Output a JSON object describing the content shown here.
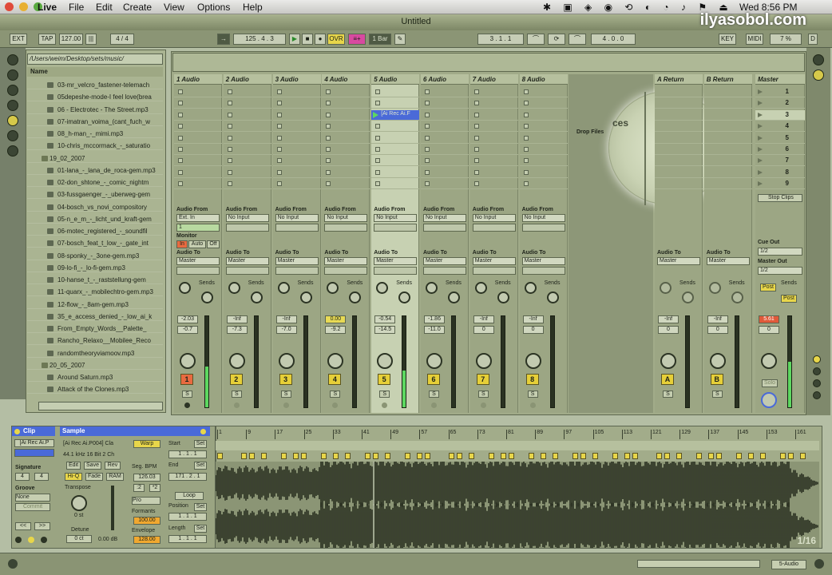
{
  "menubar": {
    "app_name": "Live",
    "items": [
      "File",
      "Edit",
      "Create",
      "View",
      "Options",
      "Help"
    ],
    "clock": "Wed 8:56 PM"
  },
  "window": {
    "title": "Untitled",
    "watermark": "ilyasobol.com"
  },
  "transport": {
    "ext": "EXT",
    "tap": "TAP",
    "tempo": "127.00",
    "bars": "4 / 4",
    "position": "125 .  4 .  3",
    "ovr": "OVR",
    "quantize": "1 Bar",
    "loop_start": "3 .  1 .  1",
    "loop_len": "4 .  0 .  0",
    "key": "KEY",
    "midi": "MIDI",
    "cpu": "7 %",
    "d": "D"
  },
  "browser": {
    "path": "/Users/weim/Desktop/sets/music/",
    "header": "Name",
    "items": [
      {
        "label": "03-mr_velcro_fastener-telemach",
        "type": "file"
      },
      {
        "label": "05depeshe-mode-I feel love(brea",
        "type": "file"
      },
      {
        "label": "06 - Electrotec - The Street.mp3",
        "type": "file"
      },
      {
        "label": "07-imatran_voima_(cant_fuch_w",
        "type": "file"
      },
      {
        "label": "08_h-man_-_mimi.mp3",
        "type": "file"
      },
      {
        "label": "10-chris_mccormack_-_saturatio",
        "type": "file"
      },
      {
        "label": "19_02_2007",
        "type": "folder"
      },
      {
        "label": "01-lana_-_lana_de_roca-gem.mp3",
        "type": "file"
      },
      {
        "label": "02-don_shtone_-_comic_nightm",
        "type": "file"
      },
      {
        "label": "03-fussgaenger_-_uberweg-gem",
        "type": "file"
      },
      {
        "label": "04-bosch_vs_novi_compository",
        "type": "file"
      },
      {
        "label": "05-n_e_m_-_licht_und_kraft-gem",
        "type": "file"
      },
      {
        "label": "06-motec_registered_-_soundfil",
        "type": "file"
      },
      {
        "label": "07-bosch_feat_t_low_-_gate_int",
        "type": "file"
      },
      {
        "label": "08-sponky_-_3one-gem.mp3",
        "type": "file"
      },
      {
        "label": "09-lo-fi_-_lo-fi-gem.mp3",
        "type": "file"
      },
      {
        "label": "10-hanse_t_-_raststellung-gem",
        "type": "file"
      },
      {
        "label": "11-quarx_-_mobilechtro-gem.mp3",
        "type": "file"
      },
      {
        "label": "12-flow_-_8am-gem.mp3",
        "type": "file"
      },
      {
        "label": "35_e_access_denied_-_low_ai_k",
        "type": "file"
      },
      {
        "label": "From_Empty_Words__Palette_",
        "type": "file"
      },
      {
        "label": "Rancho_Relaxo__Mobilee_Reco",
        "type": "file"
      },
      {
        "label": "randomtheoryviamoov.mp3",
        "type": "file"
      },
      {
        "label": "20_05_2007",
        "type": "folder"
      },
      {
        "label": "Around Saturn.mp3",
        "type": "file"
      },
      {
        "label": "Attack of the Clones.mp3",
        "type": "file"
      }
    ]
  },
  "tracks": [
    {
      "name": "1 Audio",
      "audio_from": "Ext. In",
      "channel": "1",
      "num": "1",
      "vol": "-2.03",
      "pan": "-0.7",
      "meter": 0.45,
      "armed": true
    },
    {
      "name": "2 Audio",
      "audio_from": "No Input",
      "num": "2",
      "vol": "-Inf",
      "pan": "-7.3",
      "meter": 0
    },
    {
      "name": "3 Audio",
      "audio_from": "No Input",
      "num": "3",
      "vol": "-Inf",
      "pan": "-7.0",
      "meter": 0
    },
    {
      "name": "4 Audio",
      "audio_from": "No Input",
      "num": "4",
      "vol": "0.00",
      "pan": "-9.2",
      "meter": 0
    },
    {
      "name": "5 Audio",
      "audio_from": "No Input",
      "num": "5",
      "vol": "-0.54",
      "pan": "-14.5",
      "meter": 0.4,
      "clip": "[Ai Rec Ai.F"
    },
    {
      "name": "6 Audio",
      "audio_from": "No Input",
      "num": "6",
      "vol": "-1.86",
      "pan": "-11.0",
      "meter": 0
    },
    {
      "name": "7 Audio",
      "audio_from": "No Input",
      "num": "7",
      "vol": "-Inf",
      "pan": "0",
      "meter": 0
    },
    {
      "name": "8 Audio",
      "audio_from": "No Input",
      "num": "8",
      "vol": "-Inf",
      "pan": "0",
      "meter": 0
    }
  ],
  "returns": [
    {
      "name": "A Return",
      "num": "A",
      "vol": "-Inf",
      "pan": "0"
    },
    {
      "name": "B Return",
      "num": "B",
      "vol": "-Inf",
      "pan": "0"
    }
  ],
  "master": {
    "name": "Master",
    "scenes": [
      "1",
      "2",
      "3",
      "4",
      "5",
      "6",
      "7",
      "8",
      "9"
    ],
    "vol": "5.61",
    "pan": "0",
    "stop_clips": "Stop Clips",
    "cue_out_label": "Cue Out",
    "cue_out": "1/2",
    "master_out_label": "Master Out",
    "master_out": "1/2",
    "post": "Post",
    "solo": "Solo"
  },
  "labels": {
    "audio_from": "Audio From",
    "audio_to": "Audio To",
    "master": "Master",
    "monitor": "Monitor",
    "mon_in": "In",
    "mon_auto": "Auto",
    "mon_off": "Off",
    "sends": "Sends",
    "solo": "S",
    "drop_files": "Drop Files",
    "drop_ces": "ces"
  },
  "clip": {
    "title": "Clip",
    "name": "[Ai Rec Ai.P",
    "signature_label": "Signature",
    "sig_num": "4",
    "sig_den": "4",
    "groove_label": "Groove",
    "groove": "None",
    "commit": "Commit"
  },
  "sample": {
    "title": "Sample",
    "name": "[Ai Rec Ai.P004] Cla",
    "info": "44.1 kHz 16 Bit 2 Ch",
    "warp": "Warp",
    "edit": "Edit",
    "save": "Save",
    "rev": "Rev",
    "hiq": "Hi-Q",
    "fade": "Fade",
    "ram": "RAM",
    "transpose_label": "Transpose",
    "transpose": "0 st",
    "detune_label": "Detune",
    "detune": "0 ct",
    "gain": "0.00 dB",
    "seg_bpm_label": "Seg. BPM",
    "seg_bpm": "126.03",
    "half": ":2",
    "double": "*2",
    "mode": "Pro",
    "formants_label": "Formants",
    "formants": "100.00",
    "envelope_label": "Envelope",
    "envelope": "128.00",
    "start_label": "Start",
    "start": "1 . 1 . 1",
    "end_label": "End",
    "end": "171 . 2 . 1",
    "loop": "Loop",
    "position_label": "Position",
    "position": "1 . 1 . 1",
    "length_label": "Length",
    "length": "1 . 1 . 1",
    "set": "Set",
    "zoom": "1/16"
  },
  "ruler": [
    "1",
    "9",
    "17",
    "25",
    "33",
    "41",
    "49",
    "57",
    "65",
    "73",
    "81",
    "89",
    "97",
    "105",
    "113",
    "121",
    "129",
    "137",
    "145",
    "153",
    "161"
  ],
  "statusbar": {
    "track": "5-Audio"
  }
}
